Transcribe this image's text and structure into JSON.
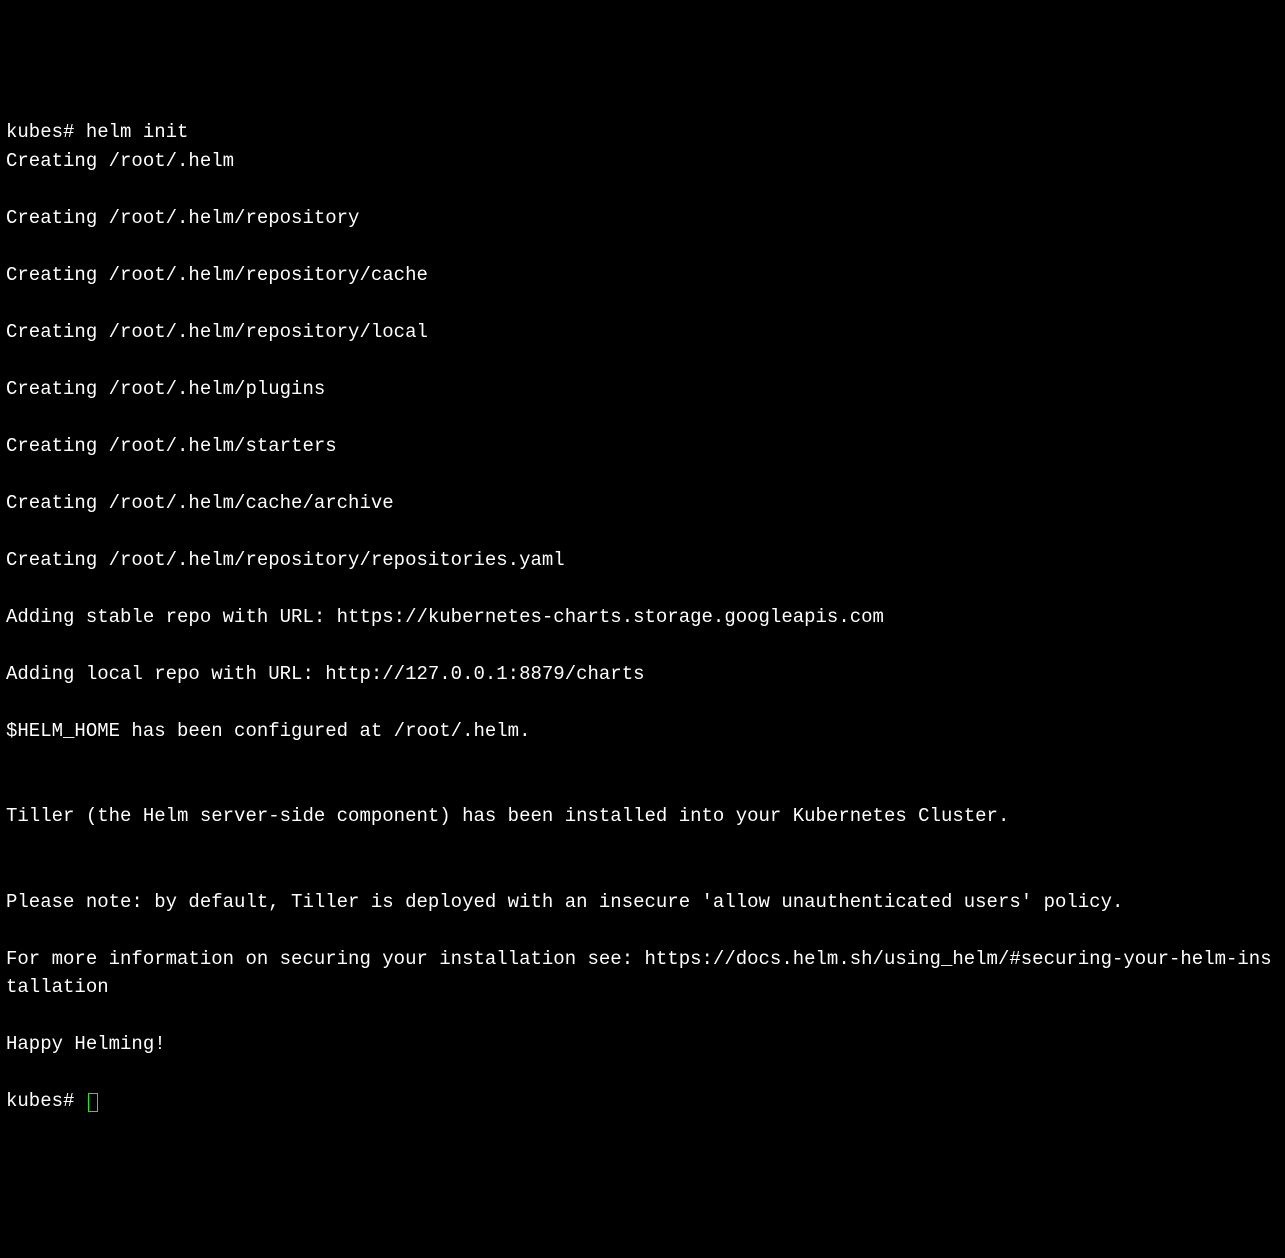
{
  "terminal": {
    "prompt1": "kubes# ",
    "command": "helm init",
    "output_lines": [
      "Creating /root/.helm",
      "Creating /root/.helm/repository",
      "Creating /root/.helm/repository/cache",
      "Creating /root/.helm/repository/local",
      "Creating /root/.helm/plugins",
      "Creating /root/.helm/starters",
      "Creating /root/.helm/cache/archive",
      "Creating /root/.helm/repository/repositories.yaml",
      "Adding stable repo with URL: https://kubernetes-charts.storage.googleapis.com",
      "Adding local repo with URL: http://127.0.0.1:8879/charts",
      "$HELM_HOME has been configured at /root/.helm.",
      "",
      "Tiller (the Helm server-side component) has been installed into your Kubernetes Cluster.",
      "",
      "Please note: by default, Tiller is deployed with an insecure 'allow unauthenticated users' policy.",
      "For more information on securing your installation see: https://docs.helm.sh/using_helm/#securing-your-helm-installation",
      "Happy Helming!"
    ],
    "prompt2": "kubes# "
  }
}
